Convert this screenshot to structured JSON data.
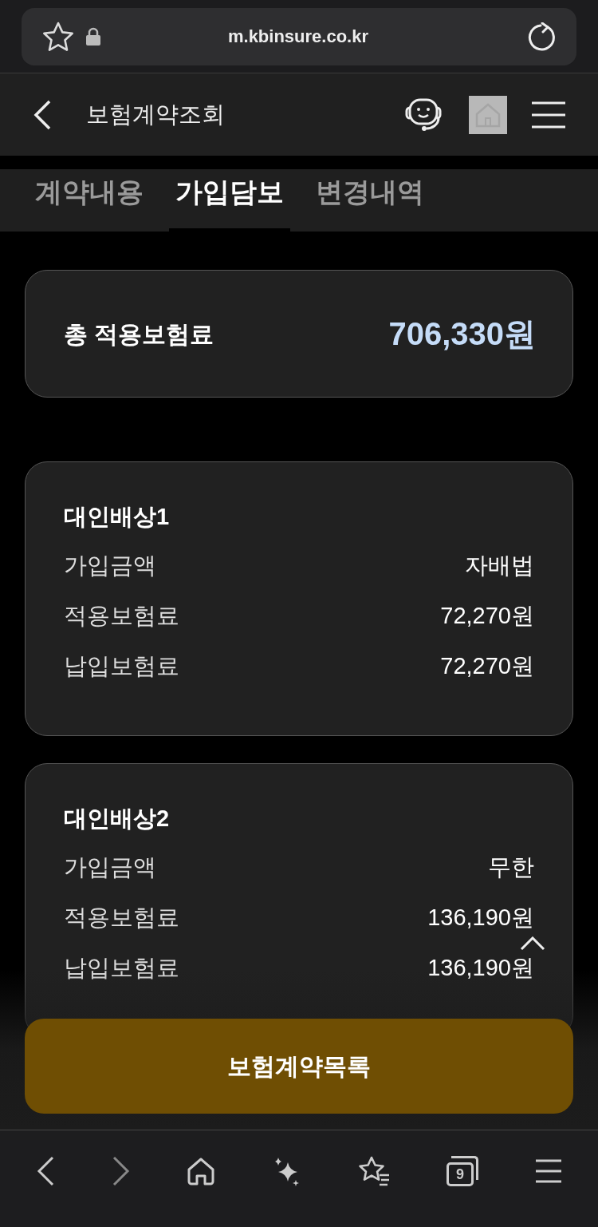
{
  "browser": {
    "url": "m.kbinsure.co.kr"
  },
  "header": {
    "title": "보험계약조회"
  },
  "tabs": [
    {
      "label": "계약내용",
      "selected": false
    },
    {
      "label": "가입담보",
      "selected": true
    },
    {
      "label": "변경내역",
      "selected": false
    }
  ],
  "total": {
    "label": "총 적용보험료",
    "value": "706,330원"
  },
  "coverages": [
    {
      "title": "대인배상1",
      "rows": [
        {
          "label": "가입금액",
          "value": "자배법"
        },
        {
          "label": "적용보험료",
          "value": "72,270원"
        },
        {
          "label": "납입보험료",
          "value": "72,270원"
        }
      ]
    },
    {
      "title": "대인배상2",
      "rows": [
        {
          "label": "가입금액",
          "value": "무한"
        },
        {
          "label": "적용보험료",
          "value": "136,190원"
        },
        {
          "label": "납입보험료",
          "value": "136,190원"
        }
      ]
    }
  ],
  "list_button": "보험계약목록",
  "bottom_bar": {
    "tab_count": "9"
  }
}
